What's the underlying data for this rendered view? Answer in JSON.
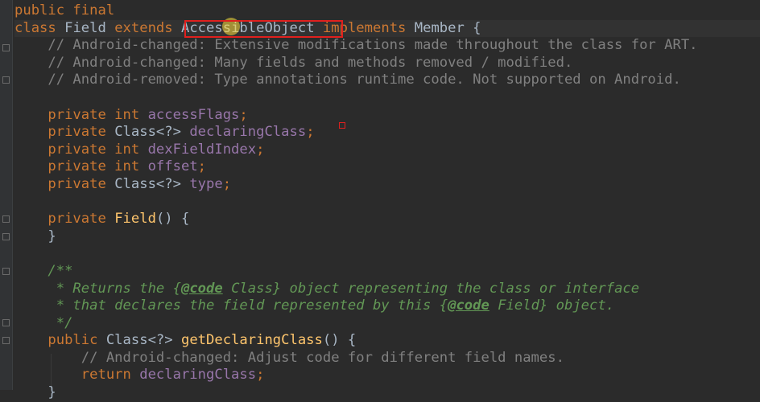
{
  "lines": [
    [
      {
        "t": "public final",
        "c": "k"
      }
    ],
    [
      {
        "t": "class ",
        "c": "k"
      },
      {
        "t": "Field",
        "c": ""
      },
      {
        "t": " extends ",
        "c": "k"
      },
      {
        "t": "AccessibleObject",
        "c": ""
      },
      {
        "t": " implements ",
        "c": "k"
      },
      {
        "t": "Member {",
        "c": ""
      }
    ],
    [
      {
        "t": "    // Android-changed: Extensive modifications made throughout the class for ART.",
        "c": "c"
      }
    ],
    [
      {
        "t": "    // Android-changed: Many fields and methods removed / modified.",
        "c": "c"
      }
    ],
    [
      {
        "t": "    // Android-removed: Type annotations runtime code. Not supported on Android.",
        "c": "c"
      }
    ],
    [
      {
        "t": "",
        "c": ""
      }
    ],
    [
      {
        "t": "    private int ",
        "c": "k"
      },
      {
        "t": "accessFlags",
        "c": "f"
      },
      {
        "t": ";",
        "c": "p"
      }
    ],
    [
      {
        "t": "    private ",
        "c": "k"
      },
      {
        "t": "Class<?> ",
        "c": ""
      },
      {
        "t": "declaringClass",
        "c": "f"
      },
      {
        "t": ";",
        "c": "p"
      }
    ],
    [
      {
        "t": "    private int ",
        "c": "k"
      },
      {
        "t": "dexFieldIndex",
        "c": "f"
      },
      {
        "t": ";",
        "c": "p"
      }
    ],
    [
      {
        "t": "    private int ",
        "c": "k"
      },
      {
        "t": "offset",
        "c": "f"
      },
      {
        "t": ";",
        "c": "p"
      }
    ],
    [
      {
        "t": "    private ",
        "c": "k"
      },
      {
        "t": "Class<?> ",
        "c": ""
      },
      {
        "t": "type",
        "c": "f"
      },
      {
        "t": ";",
        "c": "p"
      }
    ],
    [
      {
        "t": "",
        "c": ""
      }
    ],
    [
      {
        "t": "    private ",
        "c": "k"
      },
      {
        "t": "Field",
        "c": "m"
      },
      {
        "t": "() {",
        "c": ""
      }
    ],
    [
      {
        "t": "    }",
        "c": ""
      }
    ],
    [
      {
        "t": "",
        "c": ""
      }
    ],
    [
      {
        "t": "    /**",
        "c": "d"
      }
    ],
    [
      {
        "t": "     * Returns the {",
        "c": "d"
      },
      {
        "t": "@code",
        "c": "t"
      },
      {
        "t": " Class} object representing the class or interface",
        "c": "d"
      }
    ],
    [
      {
        "t": "     * that declares the field represented by this {",
        "c": "d"
      },
      {
        "t": "@code",
        "c": "t"
      },
      {
        "t": " Field} object.",
        "c": "d"
      }
    ],
    [
      {
        "t": "     */",
        "c": "d"
      }
    ],
    [
      {
        "t": "    public ",
        "c": "k"
      },
      {
        "t": "Class<?> ",
        "c": ""
      },
      {
        "t": "getDeclaringClass",
        "c": "m"
      },
      {
        "t": "() {",
        "c": ""
      }
    ],
    [
      {
        "t": "        // Android-changed: Adjust code for different field names.",
        "c": "c"
      }
    ],
    [
      {
        "t": "        return ",
        "c": "k"
      },
      {
        "t": "declaringClass",
        "c": "f"
      },
      {
        "t": ";",
        "c": "p"
      }
    ],
    [
      {
        "t": "    }",
        "c": ""
      }
    ]
  ]
}
